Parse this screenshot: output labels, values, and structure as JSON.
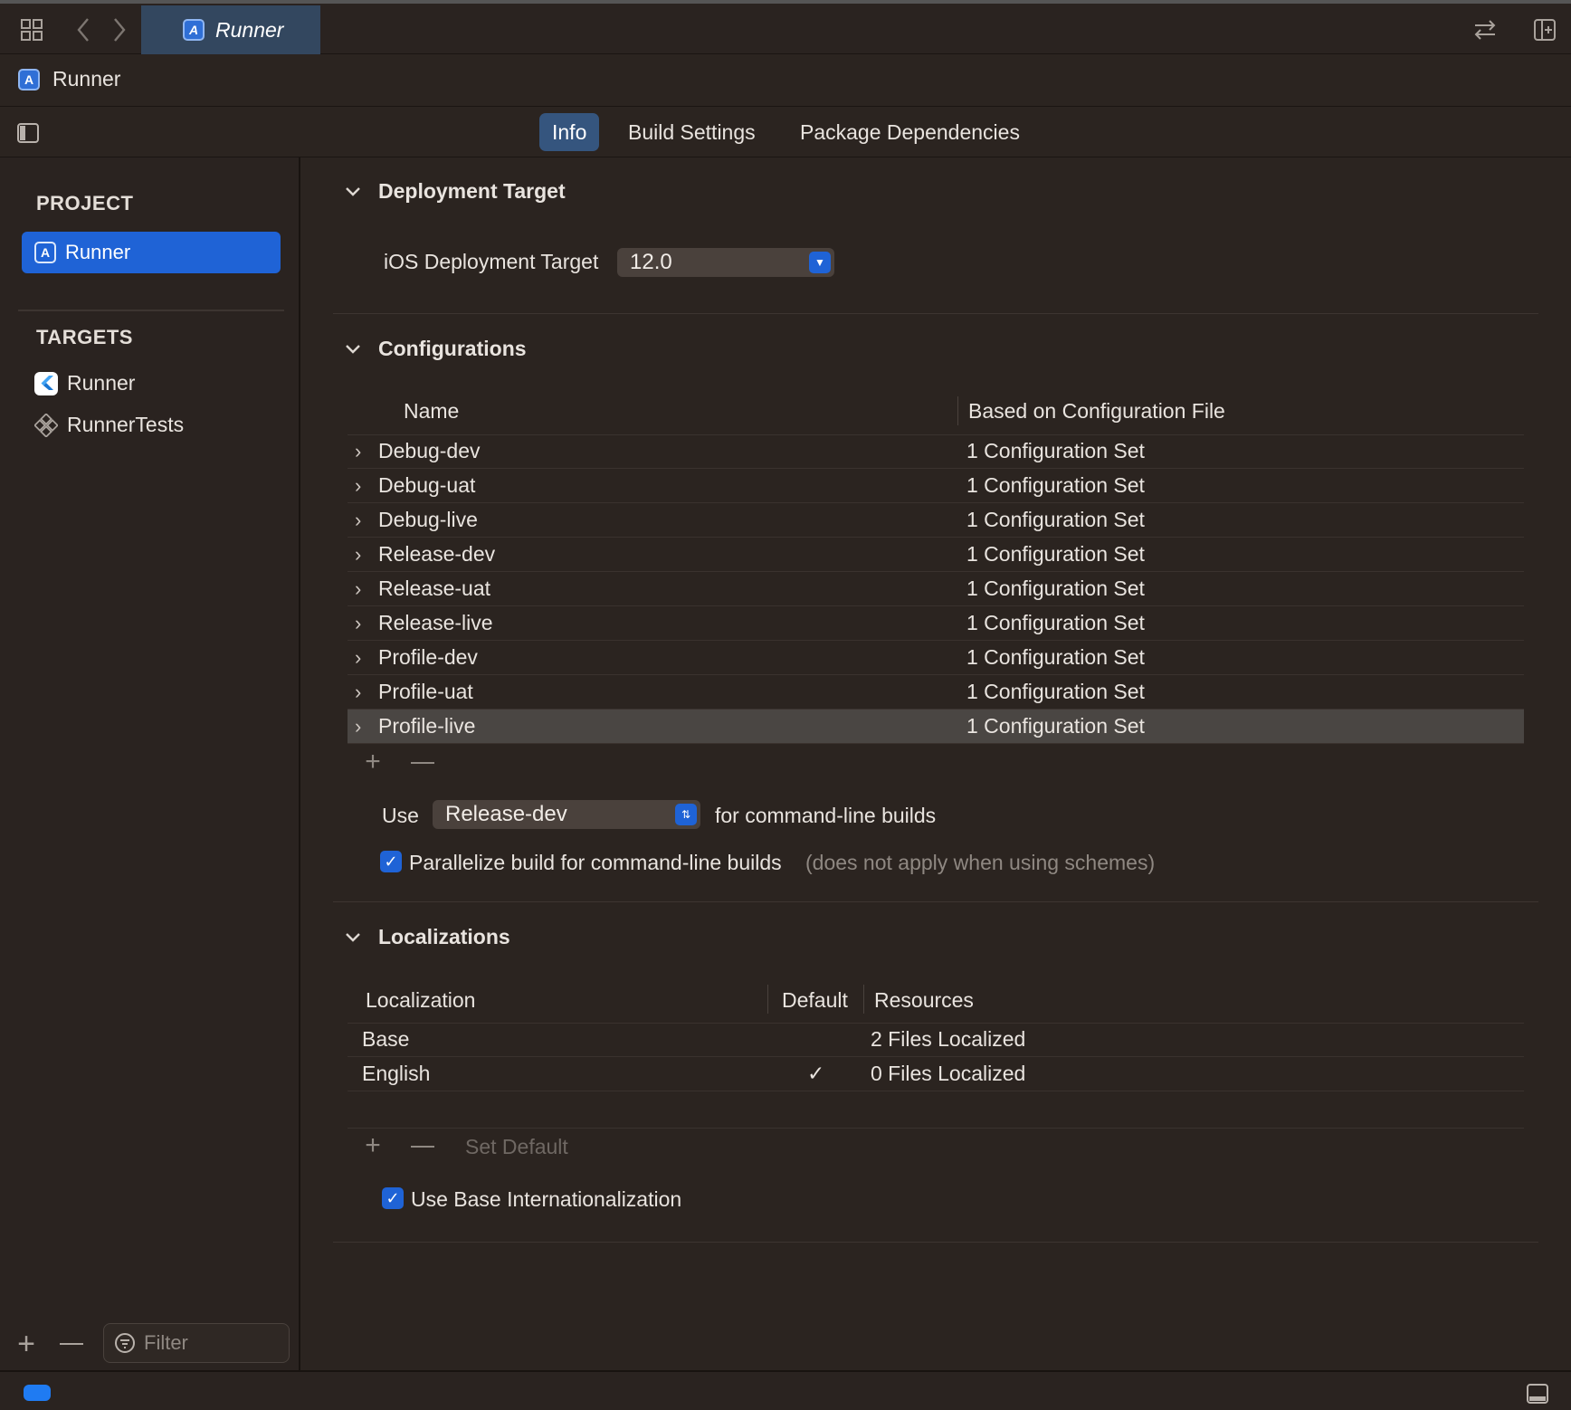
{
  "window": {
    "tab_title": "Runner",
    "breadcrumb": "Runner"
  },
  "editor_tabs": [
    {
      "label": "Info",
      "active": true
    },
    {
      "label": "Build Settings",
      "active": false
    },
    {
      "label": "Package Dependencies",
      "active": false
    }
  ],
  "sidebar": {
    "project_heading": "PROJECT",
    "project_item": "Runner",
    "targets_heading": "TARGETS",
    "targets": [
      "Runner",
      "RunnerTests"
    ],
    "filter_placeholder": "Filter"
  },
  "deployment": {
    "title": "Deployment Target",
    "label": "iOS Deployment Target",
    "value": "12.0"
  },
  "configurations": {
    "title": "Configurations",
    "col_name": "Name",
    "col_file": "Based on Configuration File",
    "rows": [
      {
        "name": "Debug-dev",
        "file": "1 Configuration Set"
      },
      {
        "name": "Debug-uat",
        "file": "1 Configuration Set"
      },
      {
        "name": "Debug-live",
        "file": "1 Configuration Set"
      },
      {
        "name": "Release-dev",
        "file": "1 Configuration Set"
      },
      {
        "name": "Release-uat",
        "file": "1 Configuration Set"
      },
      {
        "name": "Release-live",
        "file": "1 Configuration Set"
      },
      {
        "name": "Profile-dev",
        "file": "1 Configuration Set"
      },
      {
        "name": "Profile-uat",
        "file": "1 Configuration Set"
      },
      {
        "name": "Profile-live",
        "file": "1 Configuration Set"
      }
    ],
    "use_label": "Use",
    "use_value": "Release-dev",
    "use_suffix": "for command-line builds",
    "parallelize_label": "Parallelize build for command-line builds",
    "parallelize_note": "(does not apply when using schemes)"
  },
  "localizations": {
    "title": "Localizations",
    "col_localization": "Localization",
    "col_default": "Default",
    "col_resources": "Resources",
    "rows": [
      {
        "name": "Base",
        "default": "",
        "resources": "2 Files Localized"
      },
      {
        "name": "English",
        "default": "✓",
        "resources": "0 Files Localized"
      }
    ],
    "set_default": "Set Default",
    "use_base_label": "Use Base Internationalization"
  },
  "colors": {
    "accent": "#1f63d6",
    "background": "#2b2420",
    "selected_row": "#4a4643"
  }
}
